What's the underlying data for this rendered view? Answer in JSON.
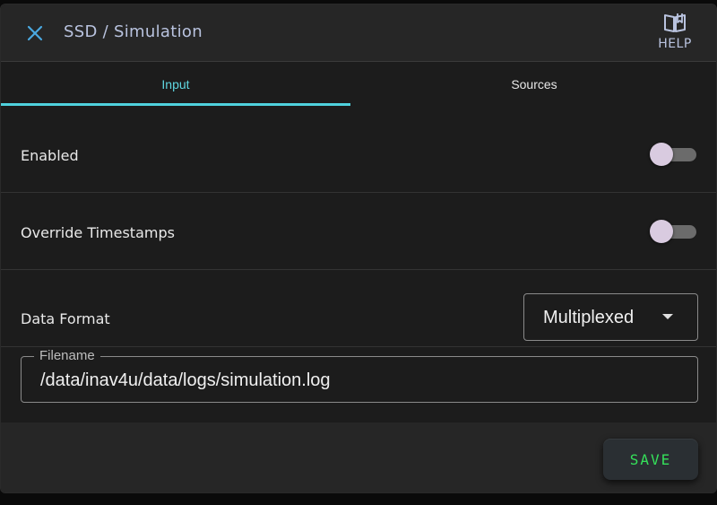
{
  "header": {
    "title": "SSD / Simulation",
    "help_label": "HELP",
    "close_icon": "close-icon",
    "help_icon": "book-icon"
  },
  "tabs": [
    {
      "label": "Input",
      "active": true
    },
    {
      "label": "Sources",
      "active": false
    }
  ],
  "settings": {
    "enabled": {
      "label": "Enabled",
      "value": false
    },
    "override_timestamps": {
      "label": "Override Timestamps",
      "value": false
    },
    "data_format": {
      "label": "Data Format",
      "value": "Multiplexed"
    },
    "filename": {
      "label": "Filename",
      "value": "/data/inav4u/data/logs/simulation.log"
    }
  },
  "footer": {
    "save_label": "SAVE"
  },
  "colors": {
    "accent": "#4fd1dd",
    "save_text": "#35e05a",
    "header_text": "#b9c3df"
  }
}
